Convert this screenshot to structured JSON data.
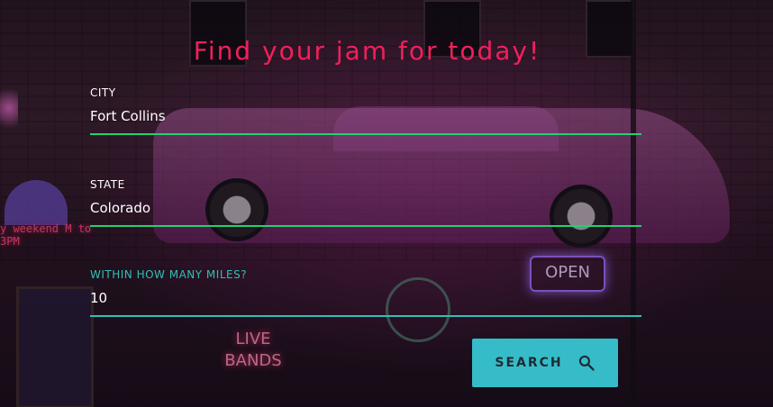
{
  "title": "Find your jam for today!",
  "form": {
    "city": {
      "label": "CITY",
      "value": "Fort Collins"
    },
    "state": {
      "label": "STATE",
      "value": "Colorado"
    },
    "miles": {
      "label": "WITHIN HOW MANY MILES?",
      "value": "10"
    }
  },
  "search_button": {
    "label": "SEARCH",
    "icon": "search-icon"
  },
  "background_signs": {
    "open": "OPEN",
    "live_bands": "LIVE BANDS",
    "weekend": "y weekend M to 3PM"
  },
  "colors": {
    "title": "#f0205c",
    "underline_default": "#20d270",
    "underline_active": "#2fc0b4",
    "button": "#36bcc9"
  }
}
